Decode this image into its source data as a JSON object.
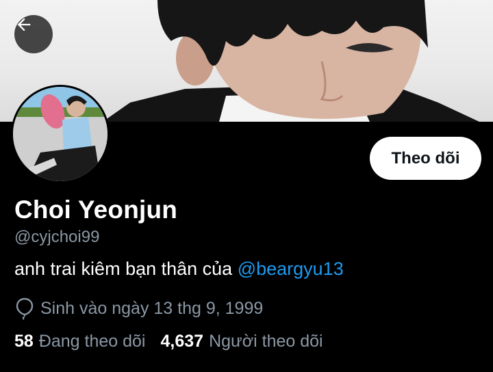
{
  "header": {
    "banner_alt": "header photo",
    "back_icon": "arrow-left-icon"
  },
  "profile": {
    "name": "Choi Yeonjun",
    "handle": "@cyjchoi99",
    "bio_text": "anh trai kiêm bạn thân của ",
    "bio_mention": "@beargyu13",
    "birth_icon": "balloon-icon",
    "birth_text": "Sinh vào ngày 13 thg 9, 1999",
    "follow_label": "Theo dõi"
  },
  "stats": {
    "following_count": "58",
    "following_label": "Đang theo dõi",
    "followers_count": "4,637",
    "followers_label": "Người theo dõi"
  },
  "colors": {
    "background": "#000000",
    "accent": "#1d9bf0",
    "secondary_text": "#8b98a5"
  }
}
